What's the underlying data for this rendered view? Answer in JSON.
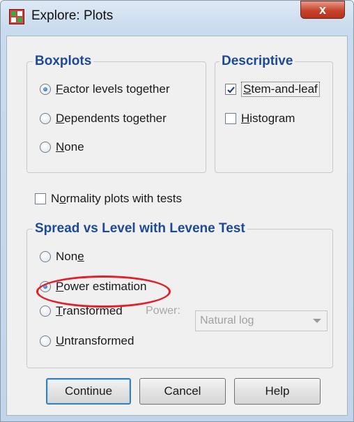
{
  "window": {
    "title": "Explore: Plots",
    "close_glyph": "x"
  },
  "boxplots": {
    "legend": "Boxplots",
    "options": [
      {
        "mn": "F",
        "rest": "actor levels together",
        "selected": true
      },
      {
        "mn": "D",
        "rest": "ependents together",
        "selected": false
      },
      {
        "mn": "N",
        "rest": "one",
        "selected": false
      }
    ]
  },
  "descriptive": {
    "legend": "Descriptive",
    "stem": {
      "mn": "S",
      "rest": "tem-and-leaf",
      "checked": true
    },
    "histogram": {
      "mn": "H",
      "rest": "istogram",
      "checked": false
    }
  },
  "normality": {
    "pre": "N",
    "mn": "o",
    "rest": "rmality plots with tests",
    "checked": false
  },
  "spread": {
    "legend": "Spread vs Level with Levene Test",
    "none": {
      "pre": "Non",
      "mn": "e",
      "selected": false
    },
    "power_estimation": {
      "mn": "P",
      "rest": "ower estimation",
      "selected": true
    },
    "transformed": {
      "mn": "T",
      "rest": "ransformed",
      "selected": false
    },
    "power_label": "Power:",
    "power_value": "Natural log",
    "untransformed": {
      "mn": "U",
      "rest": "ntransformed",
      "selected": false
    }
  },
  "buttons": {
    "continue": "Continue",
    "cancel": "Cancel",
    "help": "Help"
  },
  "colors": {
    "legend": "#1d4a97",
    "highlight": "#e0202a",
    "title_bar": "#c9dbee"
  },
  "icons": {
    "app": "grid-app-icon",
    "check": "check-mark-icon",
    "close": "close-icon"
  }
}
